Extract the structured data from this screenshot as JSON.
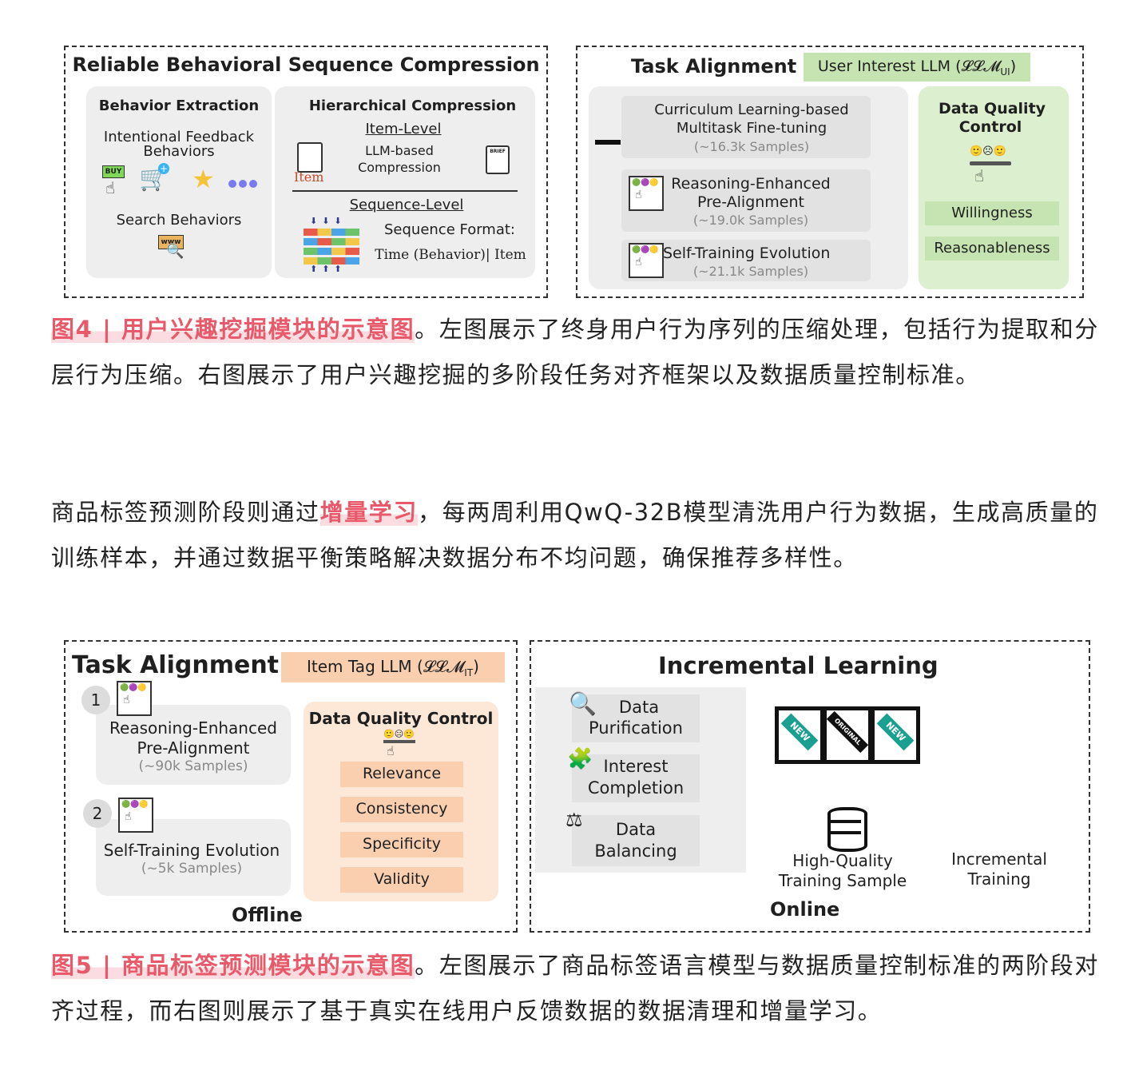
{
  "fig4": {
    "left_title": "Reliable Behavioral Sequence Compression",
    "behavior_extraction": "Behavior Extraction",
    "intentional_feedback": [
      "Intentional Feedback",
      "Behaviors"
    ],
    "buy_label": "BUY",
    "search_behaviors": "Search Behaviors",
    "www_label": "www",
    "hier_compression": "Hierarchical Compression",
    "item_level": "Item-Level",
    "item_label": "Item",
    "llm_compression": [
      "LLM-based",
      "Compression"
    ],
    "brief_label": "BRIEF",
    "sequence_level": "Sequence-Level",
    "sequence_format": "Sequence Format:",
    "sequence_format_value": "Time (Behavior)| Item",
    "right_title": "Task Alignment",
    "model_badge": "User Interest LLM (𝓛𝓛𝓜",
    "model_badge_sub": "UI",
    "model_badge_close": ")",
    "curriculum": [
      "Curriculum Learning-based",
      "Multitask Fine-tuning"
    ],
    "curriculum_samples": "(~16.3k Samples)",
    "reasoning": [
      "Reasoning-Enhanced",
      "Pre-Alignment"
    ],
    "reasoning_samples": "(~19.0k Samples)",
    "self_training": "Self-Training Evolution",
    "self_training_samples": "(~21.1k Samples)",
    "dq_title": [
      "Data Quality",
      "Control"
    ],
    "dq_items": [
      "Willingness",
      "Reasonableness"
    ]
  },
  "caption4": {
    "label": "图4 | 用户兴趣挖掘模块的示意图",
    "text": "。左图展示了终身用户行为序列的压缩处理，包括行为提取和分层行为压缩。右图展示了用户兴趣挖掘的多阶段任务对齐框架以及数据质量控制标准。"
  },
  "para": {
    "before": "商品标签预测阶段则通过",
    "highlight": "增量学习",
    "after": "，每两周利用QwQ-32B模型清洗用户行为数据，生成高质量的训练样本，并通过数据平衡策略解决数据分布不均问题，确保推荐多样性。"
  },
  "fig5": {
    "left_title": "Task Alignment",
    "model_badge": "Item Tag LLM (𝓛𝓛𝓜",
    "model_badge_sub": "IT",
    "model_badge_close": ")",
    "step1_num": "1",
    "step1": [
      "Reasoning-Enhanced",
      "Pre-Alignment"
    ],
    "step1_samples": "(~90k Samples)",
    "step2_num": "2",
    "step2": "Self-Training Evolution",
    "step2_samples": "(~5k Samples)",
    "dq_title": "Data Quality Control",
    "dq_items": [
      "Relevance",
      "Consistency",
      "Specificity",
      "Validity"
    ],
    "offline": "Offline",
    "right_title": "Incremental Learning",
    "purification": [
      "Data",
      "Purification"
    ],
    "interest": [
      "Interest",
      "Completion"
    ],
    "balancing": [
      "Data",
      "Balancing"
    ],
    "new1": "NEW",
    "original": "ORIGINAL",
    "new2": "NEW",
    "hq_sample": [
      "High-Quality",
      "Training Sample"
    ],
    "inc_training": [
      "Incremental",
      "Training"
    ],
    "online": "Online"
  },
  "caption5": {
    "label": "图5 | 商品标签预测模块的示意图",
    "text": "。左图展示了商品标签语言模型与数据质量控制标准的两阶段对齐过程，而右图则展示了基于真实在线用户反馈数据的数据清理和增量学习。"
  },
  "colors": {
    "highlight_text": "#e85a6a",
    "highlight_bg": "#fbdde1",
    "green_panel": "#dcefcf",
    "orange_panel": "#fde8d8",
    "teal": "#1aa091"
  }
}
